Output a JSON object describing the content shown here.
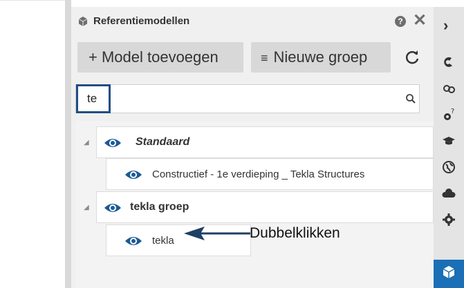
{
  "panel": {
    "title": "Referentiemodellen",
    "help_glyph": "?",
    "close_glyph": "✕"
  },
  "toolbar": {
    "add_model_label": "+ Model toevoegen",
    "new_group_icon": "≡",
    "new_group_label": "Nieuwe groep"
  },
  "search": {
    "value": "te"
  },
  "tree": {
    "rows": [
      {
        "label": "Standaard",
        "type": "group"
      },
      {
        "label": "Constructief - 1e verdieping _ Tekla Structures",
        "type": "model"
      },
      {
        "label": "tekla groep",
        "type": "group"
      },
      {
        "label": "tekla",
        "type": "model"
      }
    ]
  },
  "annotation": {
    "label": "Dubbelklikken"
  },
  "rail": {
    "expand_glyph": "›",
    "icons": [
      "services-icon",
      "view-icon",
      "help-tools-icon",
      "learning-icon",
      "globe-icon",
      "cloud-icon",
      "settings-icon",
      "reference-models-icon"
    ]
  },
  "colors": {
    "accent": "#1a6fb6",
    "eye": "#1b5a96",
    "focus_border": "#1f4e84"
  }
}
